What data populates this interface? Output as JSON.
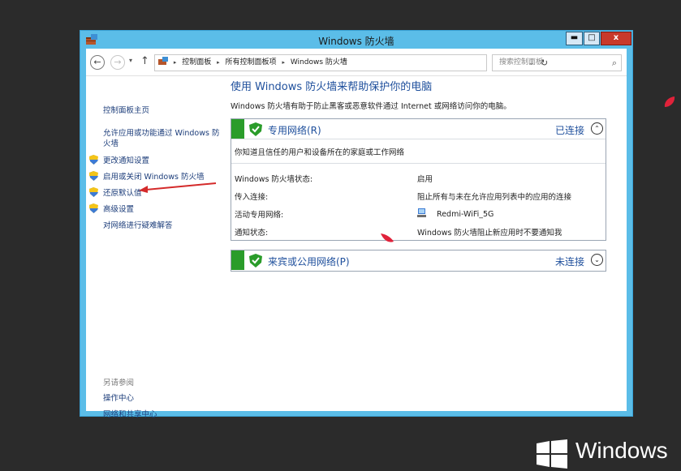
{
  "window": {
    "title": "Windows 防火墙",
    "min_glyph": "▬",
    "max_glyph": "□",
    "close_glyph": "x"
  },
  "nav": {
    "back_glyph": "←",
    "forward_glyph": "→",
    "history_glyph": "▾",
    "up_glyph": "↑",
    "breadcrumb": [
      "控制面板",
      "所有控制面板项",
      "Windows 防火墙"
    ],
    "breadcrumb_sep": "▸",
    "dropdown_glyph": "⌄",
    "refresh_glyph": "↻",
    "search_placeholder": "搜索控制面板",
    "search_glyph": "⌕"
  },
  "sidebar": {
    "home": "控制面板主页",
    "allow_app": "允许应用或功能通过 Windows 防火墙",
    "items": [
      "更改通知设置",
      "启用或关闭 Windows 防火墙",
      "还原默认值",
      "高级设置"
    ],
    "troubleshoot": "对网络进行疑难解答",
    "see_also": "另请参阅",
    "see_also_links": [
      "操作中心",
      "网络和共享中心"
    ]
  },
  "main": {
    "title": "使用 Windows 防火墙来帮助保护你的电脑",
    "description": "Windows 防火墙有助于防止黑客或恶意软件通过 Internet 或网络访问你的电脑。",
    "private": {
      "title": "专用网络(R)",
      "status": "已连接",
      "toggle_glyph": "⌃",
      "subtitle": "你知道且信任的用户和设备所在的家庭或工作网络",
      "rows": [
        {
          "key": "Windows 防火墙状态:",
          "value": "启用"
        },
        {
          "key": "传入连接:",
          "value": "阻止所有与未在允许应用列表中的应用的连接"
        },
        {
          "key": "活动专用网络:",
          "value": "Redmi-WiFi_5G"
        },
        {
          "key": "通知状态:",
          "value": "Windows 防火墙阻止新应用时不要通知我"
        }
      ]
    },
    "public": {
      "title": "来宾或公用网络(P)",
      "status": "未连接",
      "toggle_glyph": "⌄"
    }
  },
  "branding": {
    "windows_text": "Windows"
  },
  "colors": {
    "titlebar": "#5bbde8",
    "link": "#1e4f9c",
    "green": "#2a9c2a",
    "close": "#c8392b"
  }
}
